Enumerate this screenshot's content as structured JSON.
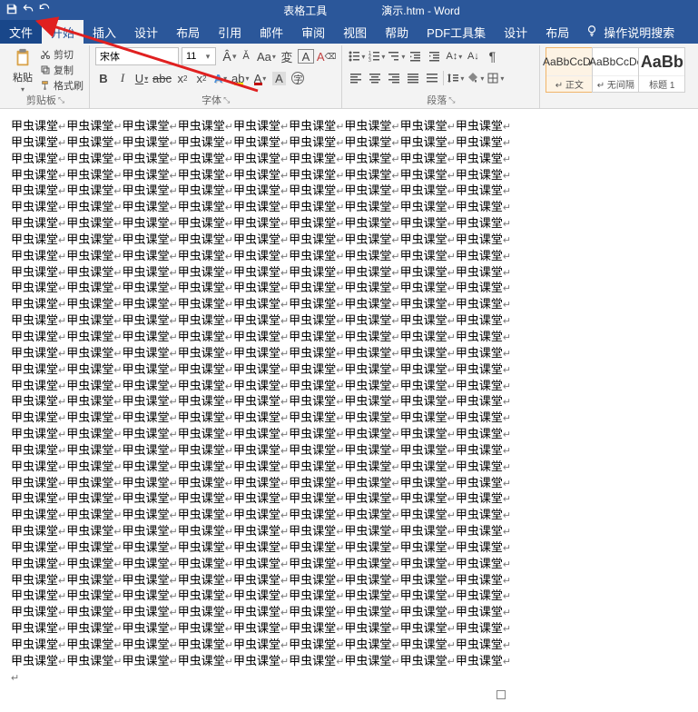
{
  "titlebar": {
    "context_tab": "表格工具",
    "doc_title": "演示.htm - Word"
  },
  "tabs": {
    "file": "文件",
    "home": "开始",
    "insert": "插入",
    "design": "设计",
    "layout": "布局",
    "references": "引用",
    "mailings": "邮件",
    "review": "审阅",
    "view": "视图",
    "help": "帮助",
    "pdf": "PDF工具集",
    "tbl_design": "设计",
    "tbl_layout": "布局",
    "tell_me": "操作说明搜索"
  },
  "clipboard": {
    "paste": "粘贴",
    "cut": "剪切",
    "copy": "复制",
    "format_painter": "格式刷",
    "group": "剪贴板"
  },
  "font": {
    "family": "宋体",
    "size": "11",
    "group": "字体",
    "bold": "B",
    "italic": "I",
    "underline": "U",
    "strike": "abc",
    "sub": "x₂",
    "sup": "x²",
    "grow": "A",
    "shrink": "A",
    "case": "Aa",
    "phonetic": "変",
    "clear": "A",
    "charborder": "A",
    "highlight": "ab",
    "fontcolor": "A"
  },
  "paragraph": {
    "group": "段落"
  },
  "styles": {
    "s1_preview": "AaBbCcDc",
    "s1_name": "↵ 正文",
    "s2_preview": "AaBbCcDc",
    "s2_name": "↵ 无间隔",
    "s3_preview": "AaBb",
    "s3_name": "标题 1"
  },
  "document": {
    "line_unit": "甲虫课堂",
    "lines": 34
  }
}
